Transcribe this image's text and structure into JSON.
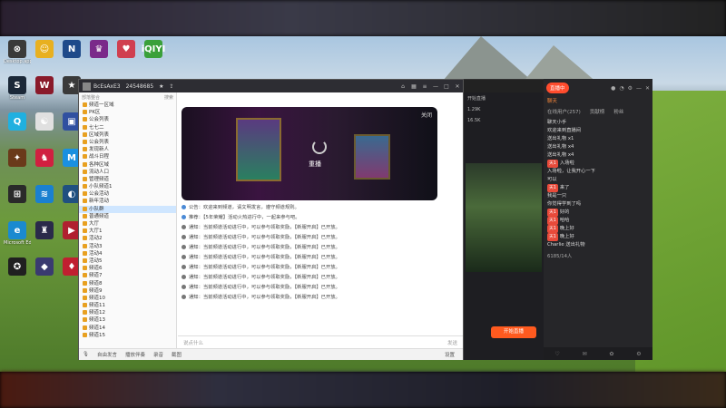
{
  "desktop_icons": [
    {
      "name": "desktop-icon-1",
      "label": "Desktop.app",
      "color": "#3a3a3a",
      "glyph": "⊗"
    },
    {
      "name": "desktop-icon-2",
      "label": "",
      "color": "#e8b020",
      "glyph": "☺"
    },
    {
      "name": "desktop-icon-3",
      "label": "",
      "color": "#1e4a8a",
      "glyph": "N"
    },
    {
      "name": "desktop-icon-4",
      "label": "",
      "color": "#7a2a8a",
      "glyph": "♛"
    },
    {
      "name": "desktop-icon-5",
      "label": "",
      "color": "#d04050",
      "glyph": "♥"
    },
    {
      "name": "desktop-icon-6",
      "label": "",
      "color": "#3aa03a",
      "glyph": "iQIYI"
    },
    {
      "name": "desktop-icon-7",
      "label": "Steam",
      "color": "#1b2838",
      "glyph": "S"
    },
    {
      "name": "desktop-icon-8",
      "label": "",
      "color": "#8a1a2a",
      "glyph": "W"
    },
    {
      "name": "desktop-icon-9",
      "label": "",
      "color": "#3a3a3a",
      "glyph": "★"
    },
    {
      "name": "desktop-icon-10",
      "label": "",
      "color": "#20b0e0",
      "glyph": "Q"
    },
    {
      "name": "desktop-icon-11",
      "label": "",
      "color": "#e0e0e0",
      "glyph": "☯"
    },
    {
      "name": "desktop-icon-12",
      "label": "",
      "color": "#3050a0",
      "glyph": "▣"
    },
    {
      "name": "desktop-icon-13",
      "label": "",
      "color": "#6a3a1a",
      "glyph": "✦"
    },
    {
      "name": "desktop-icon-14",
      "label": "",
      "color": "#d02040",
      "glyph": "♞"
    },
    {
      "name": "desktop-icon-15",
      "label": "",
      "color": "#1a90e0",
      "glyph": "M"
    },
    {
      "name": "desktop-icon-16",
      "label": "",
      "color": "#2a2a2a",
      "glyph": "⊞"
    },
    {
      "name": "desktop-icon-17",
      "label": "",
      "color": "#1a80d0",
      "glyph": "≋"
    },
    {
      "name": "desktop-icon-18",
      "label": "",
      "color": "#205080",
      "glyph": "◐"
    },
    {
      "name": "desktop-icon-19",
      "label": "Microsoft Edge",
      "color": "#1a8ad0",
      "glyph": "e"
    },
    {
      "name": "desktop-icon-20",
      "label": "",
      "color": "#2a2a4a",
      "glyph": "♜"
    },
    {
      "name": "desktop-icon-21",
      "label": "",
      "color": "#b02030",
      "glyph": "▶"
    },
    {
      "name": "desktop-icon-22",
      "label": "",
      "color": "#202020",
      "glyph": "✪"
    },
    {
      "name": "desktop-icon-23",
      "label": "",
      "color": "#3a3a70",
      "glyph": "◆"
    },
    {
      "name": "desktop-icon-24",
      "label": "",
      "color": "#c02030",
      "glyph": "♦"
    }
  ],
  "chat_window": {
    "title": "BcEsAxE3",
    "room_id": "24548685",
    "sidebar_header": "部落整合",
    "sidebar_right": "搜索",
    "tree": [
      "频道一区域",
      "PK区",
      "公会列表",
      "七七二",
      "区域列表",
      "公会列表",
      "发现新人",
      "战斗日程",
      "各种区域",
      "流动人口",
      "管理频道",
      "小队频道1",
      "公会活动",
      "新年活动",
      "小队群",
      "普通频道",
      "大厅",
      "大厅1",
      "活动2",
      "活动3",
      "活动4",
      "活动5",
      "频道6",
      "频道7",
      "频道8",
      "频道9",
      "频道10",
      "频道11",
      "频道12",
      "频道13",
      "频道14",
      "频道15"
    ],
    "video": {
      "status": "重播",
      "close": "关闭"
    },
    "messages": [
      {
        "type": "note",
        "text": "公告：欢迎来到频道，请文明发言，遵守频道规则。"
      },
      {
        "type": "note",
        "text": "推荐：【5年荣耀】活动火热进行中，一起来参与吧。"
      },
      {
        "type": "msg",
        "text": "通知：当前频道活动进行中，可以参与领取奖励，【新服开启】已开放。"
      },
      {
        "type": "msg",
        "text": "通知：当前频道活动进行中，可以参与领取奖励，【新服开启】已开放。"
      },
      {
        "type": "msg",
        "text": "通知：当前频道活动进行中，可以参与领取奖励，【新服开启】已开放。"
      },
      {
        "type": "msg",
        "text": "通知：当前频道活动进行中，可以参与领取奖励，【新服开启】已开放。"
      },
      {
        "type": "msg",
        "text": "通知：当前频道活动进行中，可以参与领取奖励，【新服开启】已开放。"
      },
      {
        "type": "msg",
        "text": "通知：当前频道活动进行中，可以参与领取奖励，【新服开启】已开放。"
      },
      {
        "type": "msg",
        "text": "通知：当前频道活动进行中，可以参与领取奖励，【新服开启】已开放。"
      },
      {
        "type": "msg",
        "text": "通知：当前频道活动进行中，可以参与领取奖励，【新服开启】已开放。"
      }
    ],
    "input_placeholder": "说点什么",
    "input_right": "发送",
    "bottom_items": [
      "自由发言",
      "播放伴奏",
      "录音",
      "截图"
    ],
    "bottom_right": "设置"
  },
  "mid_window": {
    "rows": [
      "开始直播",
      "1.29K",
      "16.5K"
    ],
    "button": "开始直播"
  },
  "live_window": {
    "pill": "直播中",
    "tabs": [
      "在线用户(257)",
      "贡献榜",
      "粉丝"
    ],
    "header_tab": "聊天",
    "sub": "6185/14人",
    "chat": [
      {
        "tag": "",
        "tag_color": "red",
        "name": "",
        "text": "聊天小手"
      },
      {
        "tag": "",
        "tag_color": "red",
        "name": "",
        "text": "欢迎来到直播间"
      },
      {
        "tag": "",
        "tag_color": "red",
        "name": "",
        "text": "送出礼物 x1"
      },
      {
        "tag": "",
        "tag_color": "red",
        "name": "",
        "text": "送出礼物 x4"
      },
      {
        "tag": "",
        "tag_color": "red",
        "name": "",
        "text": "送出礼物 x4"
      },
      {
        "tag": "天1",
        "tag_color": "red",
        "name": "",
        "text": "入场啦"
      },
      {
        "tag": "",
        "tag_color": "red",
        "name": "",
        "text": "入场啦，让我开心一下"
      },
      {
        "tag": "",
        "tag_color": "blue",
        "name": "",
        "text": "可以"
      },
      {
        "tag": "天1",
        "tag_color": "red",
        "name": "",
        "text": "来了"
      },
      {
        "tag": "",
        "tag_color": "green",
        "name": "",
        "text": "我是一只"
      },
      {
        "tag": "",
        "tag_color": "blue",
        "name": "",
        "text": "你觉得学到了吗"
      },
      {
        "tag": "天1",
        "tag_color": "red",
        "name": "",
        "text": "好的"
      },
      {
        "tag": "天1",
        "tag_color": "red",
        "name": "",
        "text": "哈哈"
      },
      {
        "tag": "天1",
        "tag_color": "red",
        "name": "",
        "text": "晚上好"
      },
      {
        "tag": "天1",
        "tag_color": "red",
        "name": "",
        "text": "晚上好"
      },
      {
        "tag": "",
        "tag_color": "red",
        "name": "",
        "text": "Charlie 送出礼物"
      }
    ],
    "footer_icons": [
      "♡",
      "✉",
      "✿",
      "⚙"
    ]
  },
  "colors": {
    "accent_orange": "#ff5a1f",
    "live_bg": "#262629",
    "chat_titlebar": "#2d2d33"
  }
}
